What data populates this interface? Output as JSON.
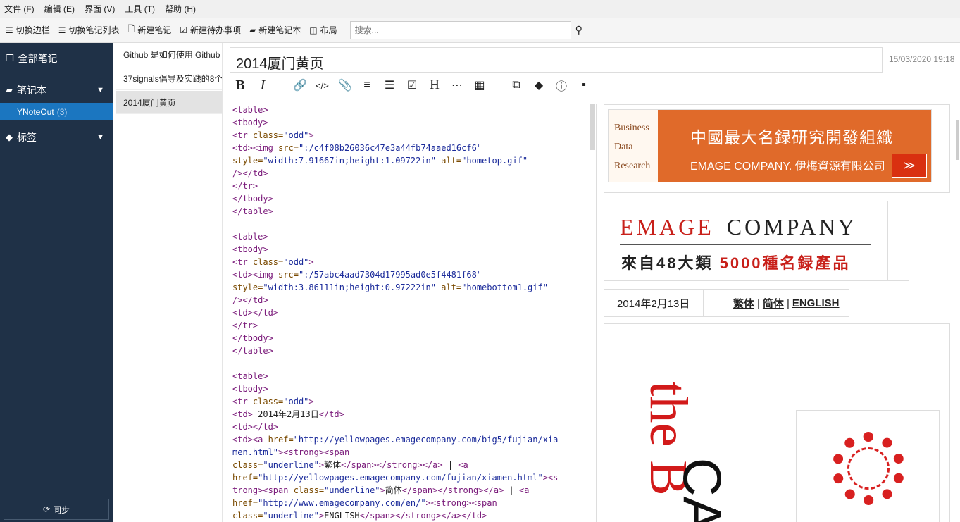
{
  "menu": [
    "文件 (F)",
    "编辑 (E)",
    "界面 (V)",
    "工具 (T)",
    "帮助 (H)"
  ],
  "toolbar": {
    "toggle_sidebar": "切换边栏",
    "toggle_notelist": "切换笔记列表",
    "new_note": "新建笔记",
    "new_todo": "新建待办事项",
    "new_notebook": "新建笔记本",
    "layout": "布局",
    "search_placeholder": "搜索..."
  },
  "sidebar": {
    "all_notes": "全部笔记",
    "notebooks": "笔记本",
    "notebook_item": "YNoteOut",
    "notebook_count": "(3)",
    "tags": "标签",
    "sync": "同步"
  },
  "notes": [
    "Github 是如何使用 Github",
    "37signals倡导及实践的8个",
    "2014厦门黄页"
  ],
  "editor": {
    "title": "2014厦门黄页",
    "date": "15/03/2020 19:18"
  },
  "preview": {
    "banner_left": "Business Data Research",
    "banner_title": "中國最大名録研究開發組織",
    "banner_sub": "EMAGE COMPANY. 伊梅資源有限公司",
    "banner_arrow": "≫",
    "logo_emage": "EMAGE",
    "logo_company": "COMPANY",
    "logo_line_a": "來自48大類 ",
    "logo_line_b": "5000種名録產品",
    "date_cell": "2014年2月13日",
    "link_trad": "繁体",
    "link_simp": "简体",
    "link_en": "ENGLISH",
    "sep": "|",
    "img_text_1": "the B",
    "img_text_2": "CA"
  }
}
